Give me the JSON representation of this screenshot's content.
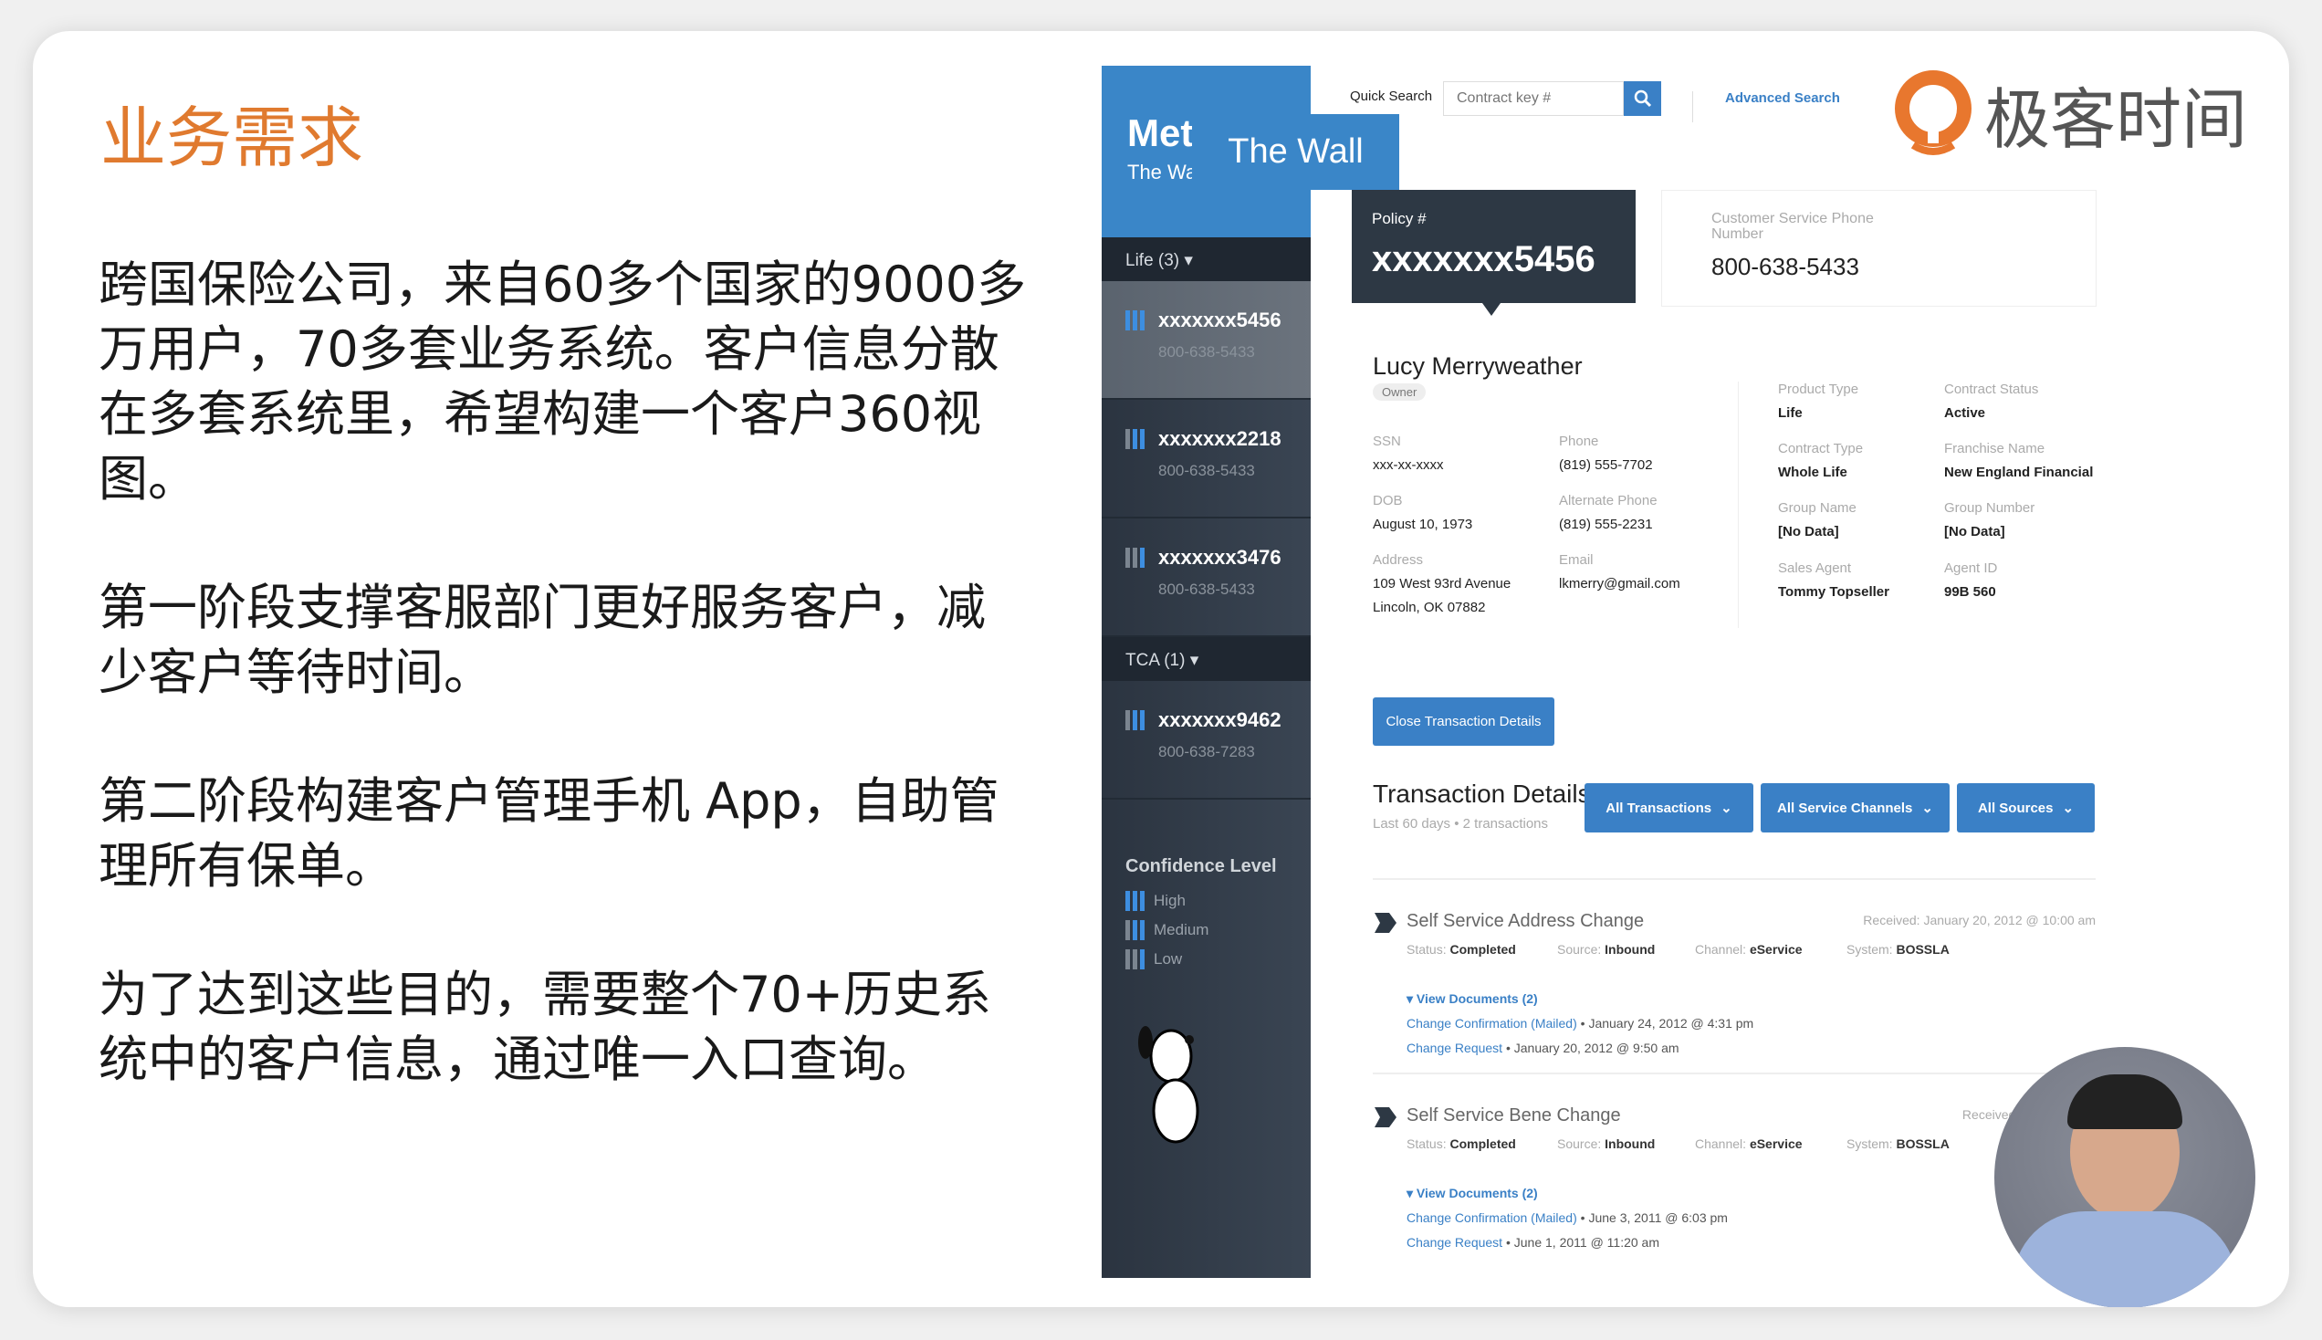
{
  "slide": {
    "title": "业务需求",
    "paragraphs": [
      "跨国保险公司，来自60多个国家的9000多万用户，70多套业务系统。客户信息分散在多套系统里，希望构建一个客户360视图。",
      "第一阶段支撑客服部门更好服务客户，减少客户等待时间。",
      "第二阶段构建客户管理手机 App，自助管理所有保单。",
      "为了达到这些目的，需要整个70+历史系统中的客户信息，通过唯一入口查询。"
    ]
  },
  "logo": {
    "text": "极客时间",
    "color": "#e8772e"
  },
  "app": {
    "brand": "Met",
    "brand_sub": "The Wa",
    "tooltip": "The Wall",
    "header": {
      "quick_search_label": "Quick Search",
      "search_placeholder": "Contract key #",
      "advanced_search": "Advanced Search"
    },
    "sidebar": {
      "groups": [
        {
          "label": "Life (3) ▾"
        },
        {
          "label": "TCA (1) ▾"
        }
      ],
      "policies": [
        {
          "number": "xxxxxxx5456",
          "phone": "800-638-5433",
          "selected": true
        },
        {
          "number": "xxxxxxx2218",
          "phone": "800-638-5433"
        },
        {
          "number": "xxxxxxx3476",
          "phone": "800-638-5433"
        },
        {
          "number": "xxxxxxx9462",
          "phone": "800-638-7283"
        }
      ],
      "confidence_title": "Confidence Level",
      "levels": [
        "High",
        "Medium",
        "Low"
      ]
    },
    "policy": {
      "label": "Policy #",
      "number": "xxxxxxx5456"
    },
    "cs_phone": {
      "label": "Customer Service Phone Number",
      "value": "800-638-5433"
    },
    "customer": {
      "name": "Lucy Merryweather",
      "role": "Owner",
      "fields": [
        {
          "label": "SSN",
          "value": "xxx-xx-xxxx"
        },
        {
          "label": "Phone",
          "value": "(819) 555-7702"
        },
        {
          "label": "DOB",
          "value": "August 10, 1973"
        },
        {
          "label": "Alternate Phone",
          "value": "(819) 555-2231"
        },
        {
          "label": "Address",
          "value": "109 West 93rd Avenue",
          "value2": "Lincoln, OK 07882"
        },
        {
          "label": "Email",
          "value": "lkmerry@gmail.com"
        }
      ],
      "contract": [
        {
          "label": "Product Type",
          "value": "Life"
        },
        {
          "label": "Contract Status",
          "value": "Active"
        },
        {
          "label": "Contract Type",
          "value": "Whole Life"
        },
        {
          "label": "Franchise Name",
          "value": "New England Financial"
        },
        {
          "label": "Group Name",
          "value": "[No Data]"
        },
        {
          "label": "Group Number",
          "value": "[No Data]"
        },
        {
          "label": "Sales Agent",
          "value": "Tommy Topseller"
        },
        {
          "label": "Agent ID",
          "value": "99B 560"
        }
      ]
    },
    "close_button": "Close Transaction Details",
    "transactions": {
      "title": "Transaction Details",
      "subtitle": "Last 60 days • 2 transactions",
      "filters": [
        "All Transactions",
        "All Service Channels",
        "All Sources"
      ],
      "items": [
        {
          "title": "Self Service Address Change",
          "received": "Received: January 20, 2012 @ 10:00 am",
          "status": "Completed",
          "source": "Inbound",
          "channel": "eService",
          "system": "BOSSLA",
          "view_docs": "View Documents (2)",
          "docs": [
            {
              "name": "Change Confirmation (Mailed)",
              "date": "• January 24, 2012 @ 4:31 pm"
            },
            {
              "name": "Change Request",
              "date": "• January 20, 2012 @ 9:50 am"
            }
          ]
        },
        {
          "title": "Self Service Bene Change",
          "received": "Received: June 1, 2011",
          "status": "Completed",
          "source": "Inbound",
          "channel": "eService",
          "system": "BOSSLA",
          "view_docs": "View Documents (2)",
          "docs": [
            {
              "name": "Change Confirmation (Mailed)",
              "date": "• June 3, 2011 @ 6:03 pm"
            },
            {
              "name": "Change Request",
              "date": "• June 1, 2011 @ 11:20 am"
            }
          ]
        }
      ]
    },
    "labels": {
      "status": "Status:",
      "source": "Source:",
      "channel": "Channel:",
      "system": "System:"
    }
  }
}
